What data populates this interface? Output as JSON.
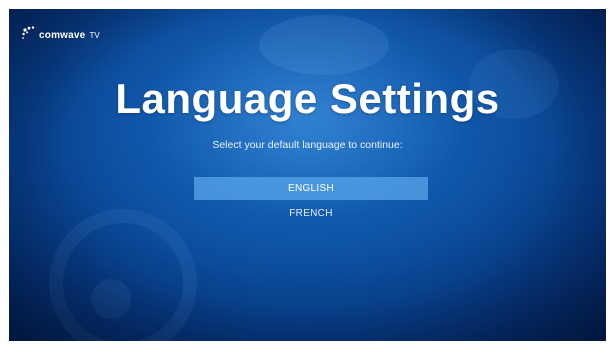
{
  "logo": {
    "brand": "comwave",
    "suffix": "TV",
    "icon": "comwave-dots-logo"
  },
  "page": {
    "title": "Language Settings",
    "subtitle": "Select your default language to continue:"
  },
  "languages": {
    "options": [
      {
        "label": "ENGLISH",
        "selected": true
      },
      {
        "label": "FRENCH",
        "selected": false
      }
    ]
  },
  "colors": {
    "background_center": "#0f5fb5",
    "background_edge": "#031d4e",
    "selected_highlight": "#5aa5eb",
    "text": "#ffffff"
  }
}
